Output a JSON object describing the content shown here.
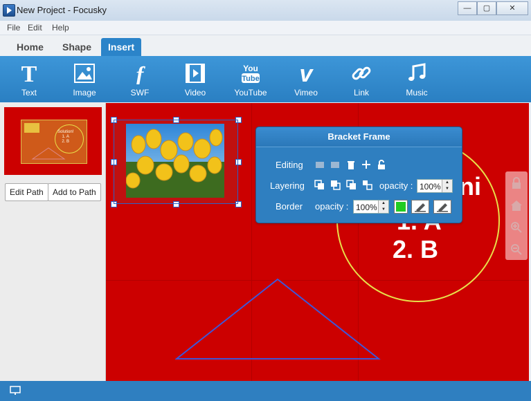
{
  "window": {
    "title": "New Project - Focusky",
    "min": "—",
    "max": "▢",
    "close": "✕"
  },
  "menu": [
    "File",
    "Edit",
    "Help"
  ],
  "tabs": [
    "Home",
    "Shape",
    "Insert"
  ],
  "active_tab": "Insert",
  "ribbon": {
    "tools": [
      {
        "label": "Text",
        "icon": "text-icon"
      },
      {
        "label": "Image",
        "icon": "image-icon"
      },
      {
        "label": "SWF",
        "icon": "swf-icon"
      },
      {
        "label": "Video",
        "icon": "video-icon"
      },
      {
        "label": "YouTube",
        "icon": "youtube-icon"
      },
      {
        "label": "Vimeo",
        "icon": "vimeo-icon"
      },
      {
        "label": "Link",
        "icon": "link-icon"
      },
      {
        "label": "Music",
        "icon": "music-icon"
      }
    ]
  },
  "leftpanel": {
    "thumb_text": [
      "Solution!",
      "1. A",
      "2. B"
    ],
    "edit_path": "Edit Path",
    "add_to_path": "Add to Path"
  },
  "canvas": {
    "text_line1": "ni",
    "text_line2": "1. A",
    "text_line3": "2. B"
  },
  "frame_panel": {
    "title": "Bracket Frame",
    "editing_label": "Editing",
    "layering_label": "Layering",
    "border_label": "Border",
    "opacity_label": "opacity :",
    "layering_opacity": "100%",
    "border_opacity": "100%",
    "border_color": "#22cc22"
  },
  "colors": {
    "canvas": "#cc0000",
    "accent": "#2b84c9"
  }
}
